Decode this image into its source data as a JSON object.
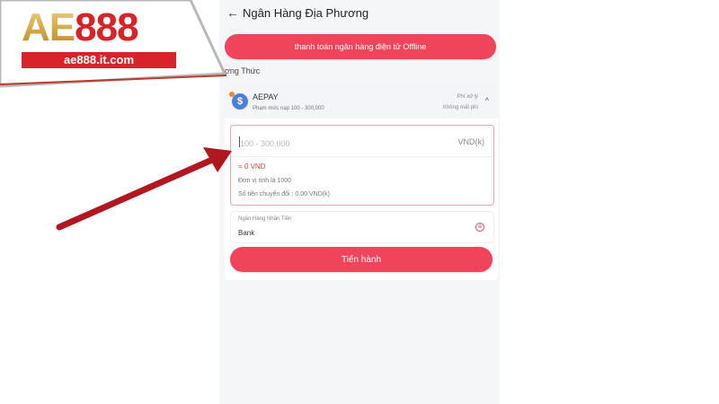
{
  "logo": {
    "brand_a": "AE",
    "brand_b": "888",
    "url": "ae888.it.com"
  },
  "header": {
    "back_icon": "←",
    "title": "Ngân Hàng Địa Phương"
  },
  "offline_button": "thanh toán ngân hàng điện tử Offline",
  "method_label": "ương Thức",
  "payment": {
    "logo_icon": "$",
    "name": "AEPAY",
    "range": "Phạm mức nạp 100 - 300,000",
    "fee_label": "Phí xử lý",
    "fee_value": "Không mất phí",
    "chevron": "^"
  },
  "amount": {
    "placeholder": "100 - 300,000",
    "unit": "VND(k)",
    "converted": "= 0 VND",
    "unit_note": "Đơn vị tính là 1000",
    "conversion_note": "Số tiền chuyển đổi : 0.00 VND(k)"
  },
  "bank": {
    "label": "Ngân Hàng Nhận Tiền",
    "value": "Bank",
    "select_icon": "⊖"
  },
  "proceed_button": "Tiến hành",
  "colors": {
    "accent": "#f0445a",
    "arrow": "#b0171e",
    "logo_red": "#d8232a",
    "logo_gold": "#c89a32"
  }
}
